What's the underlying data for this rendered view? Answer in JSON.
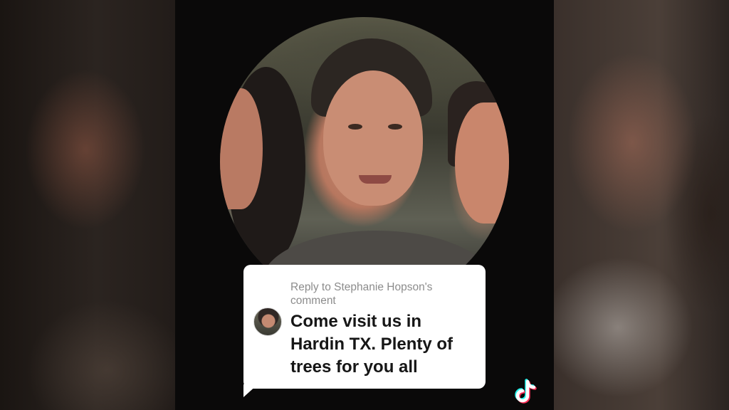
{
  "reply": {
    "header": "Reply to Stephanie Hopson's comment",
    "text": "Come visit us in Hardin TX. Plenty of trees for you all"
  },
  "icons": {
    "logo": "tiktok-icon",
    "avatar": "user-avatar"
  },
  "colors": {
    "background": "#0a0909",
    "bubble": "#ffffff",
    "header_text": "#8c8c8c",
    "body_text": "#161616"
  }
}
